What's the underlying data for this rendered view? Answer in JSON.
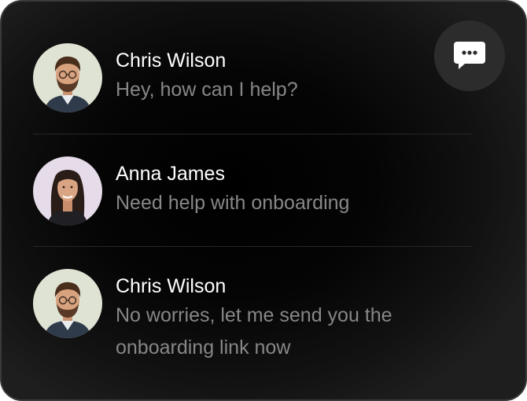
{
  "chat_icon": "chat-bubble-icon",
  "messages": [
    {
      "name": "Chris Wilson",
      "text": "Hey, how can I help?",
      "avatar": "avatar-man-icon",
      "avatar_bg": "#dfe3d4"
    },
    {
      "name": "Anna James",
      "text": "Need help with onboarding",
      "avatar": "avatar-woman-icon",
      "avatar_bg": "#e6dbe9"
    },
    {
      "name": "Chris Wilson",
      "text": "No worries, let me send you the onboarding link now",
      "avatar": "avatar-man-icon",
      "avatar_bg": "#dfe3d4"
    }
  ],
  "colors": {
    "background": "#000000",
    "name_text": "#ffffff",
    "message_text": "#878787",
    "button_bg": "#2c2c2c"
  }
}
